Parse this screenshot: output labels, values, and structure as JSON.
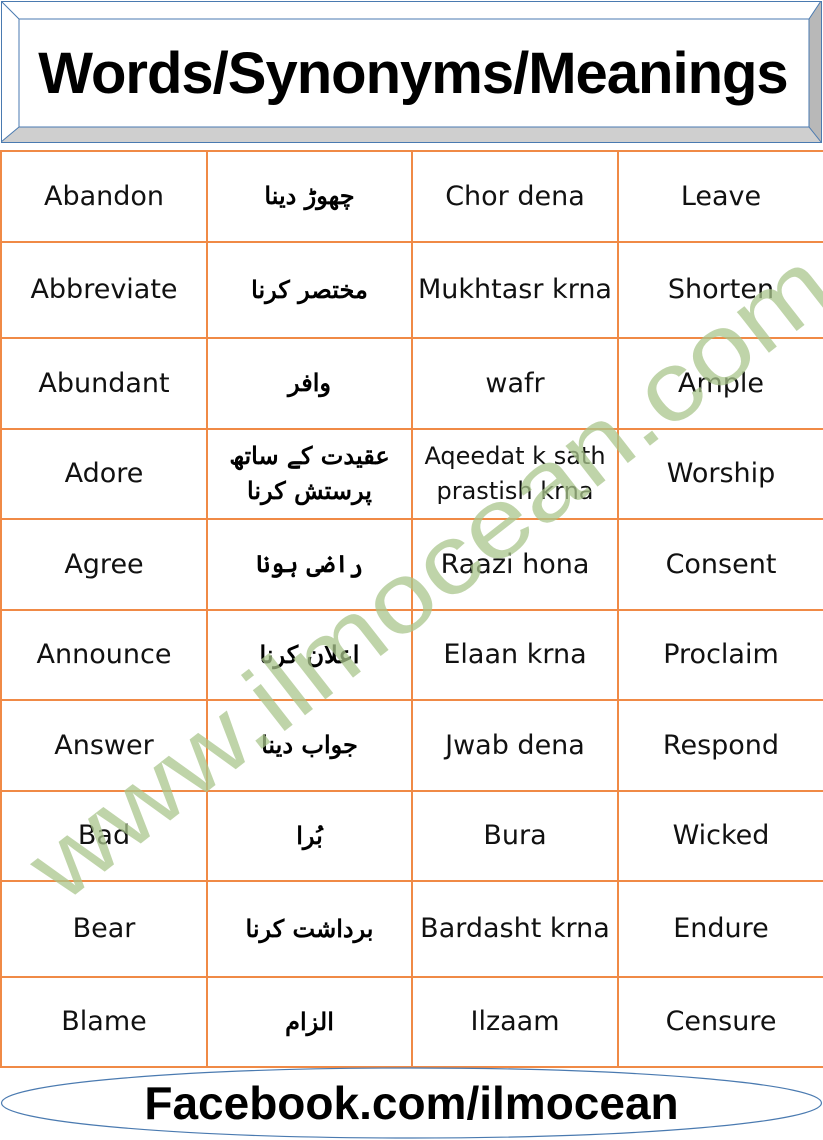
{
  "header": {
    "title": "Words/Synonyms/Meanings"
  },
  "table": {
    "rows": [
      {
        "word": "Abandon",
        "urdu": "چھوڑ دینا",
        "roman": "Chor dena",
        "synonym": "Leave"
      },
      {
        "word": "Abbreviate",
        "urdu": "مختصر کرنا",
        "roman": "Mukhtasr krna",
        "synonym": "Shorten"
      },
      {
        "word": "Abundant",
        "urdu": "وافر",
        "roman": "wafr",
        "synonym": "Ample"
      },
      {
        "word": "Adore",
        "urdu": "عقیدت کے ساتھ پرستش کرنا",
        "roman": "Aqeedat k sath prastish krna",
        "synonym": "Worship"
      },
      {
        "word": "Agree",
        "urdu": "راضی ہونا",
        "roman": "Raazi hona",
        "synonym": "Consent"
      },
      {
        "word": "Announce",
        "urdu": "اعلان کرنا",
        "roman": "Elaan krna",
        "synonym": "Proclaim"
      },
      {
        "word": "Answer",
        "urdu": "جواب دینا",
        "roman": "Jwab dena",
        "synonym": "Respond"
      },
      {
        "word": "Bad",
        "urdu": "بُرا",
        "roman": "Bura",
        "synonym": "Wicked"
      },
      {
        "word": "Bear",
        "urdu": "برداشت کرنا",
        "roman": "Bardasht krna",
        "synonym": "Endure"
      },
      {
        "word": "Blame",
        "urdu": "الزام",
        "roman": "Ilzaam",
        "synonym": "Censure"
      }
    ]
  },
  "watermark": {
    "text": "www.ilmocean.com",
    "color": "#b3cc9a"
  },
  "footer": {
    "text": "Facebook.com/ilmocean"
  },
  "colors": {
    "grid": "#f08a46",
    "frame": "#4a7ab0",
    "bevel": "#c8c8c8"
  }
}
